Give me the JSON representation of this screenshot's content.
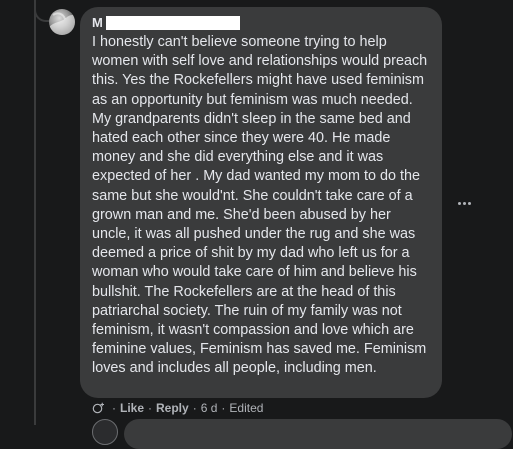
{
  "comment": {
    "author_initial": "M",
    "author_redacted": true,
    "text": "I honestly can't believe someone trying to help women with self love and relationships would preach this. Yes the Rockefellers might have used feminism as an opportunity but feminism was much needed. My grandparents didn't sleep in the same bed and hated each other since they were 40. He made money and she did everything else and it was expected of her . My dad wanted my mom to do the same but she would'nt. She couldn't take care of a grown man and me. She'd been abused by her uncle, it was all pushed under the rug and she was deemed a price of shit by my dad who left us for a woman who would take care of him and believe his bullshit. The Rockefellers are at the head of this patriarchal society. The ruin of my family was not feminism, it wasn't compassion and love which are feminine values, Feminism has saved me. Feminism loves and includes all people, including men.",
    "actions": {
      "like_label": "Like",
      "reply_label": "Reply",
      "separator": "·",
      "time": "6 d",
      "edited_label": "Edited"
    }
  },
  "icons": {
    "more": "more-options-icon",
    "react": "react-icon"
  },
  "colors": {
    "background": "#18191a",
    "bubble": "#3a3b3c",
    "text": "#e4e6eb",
    "secondary_text": "#b0b3b8"
  }
}
